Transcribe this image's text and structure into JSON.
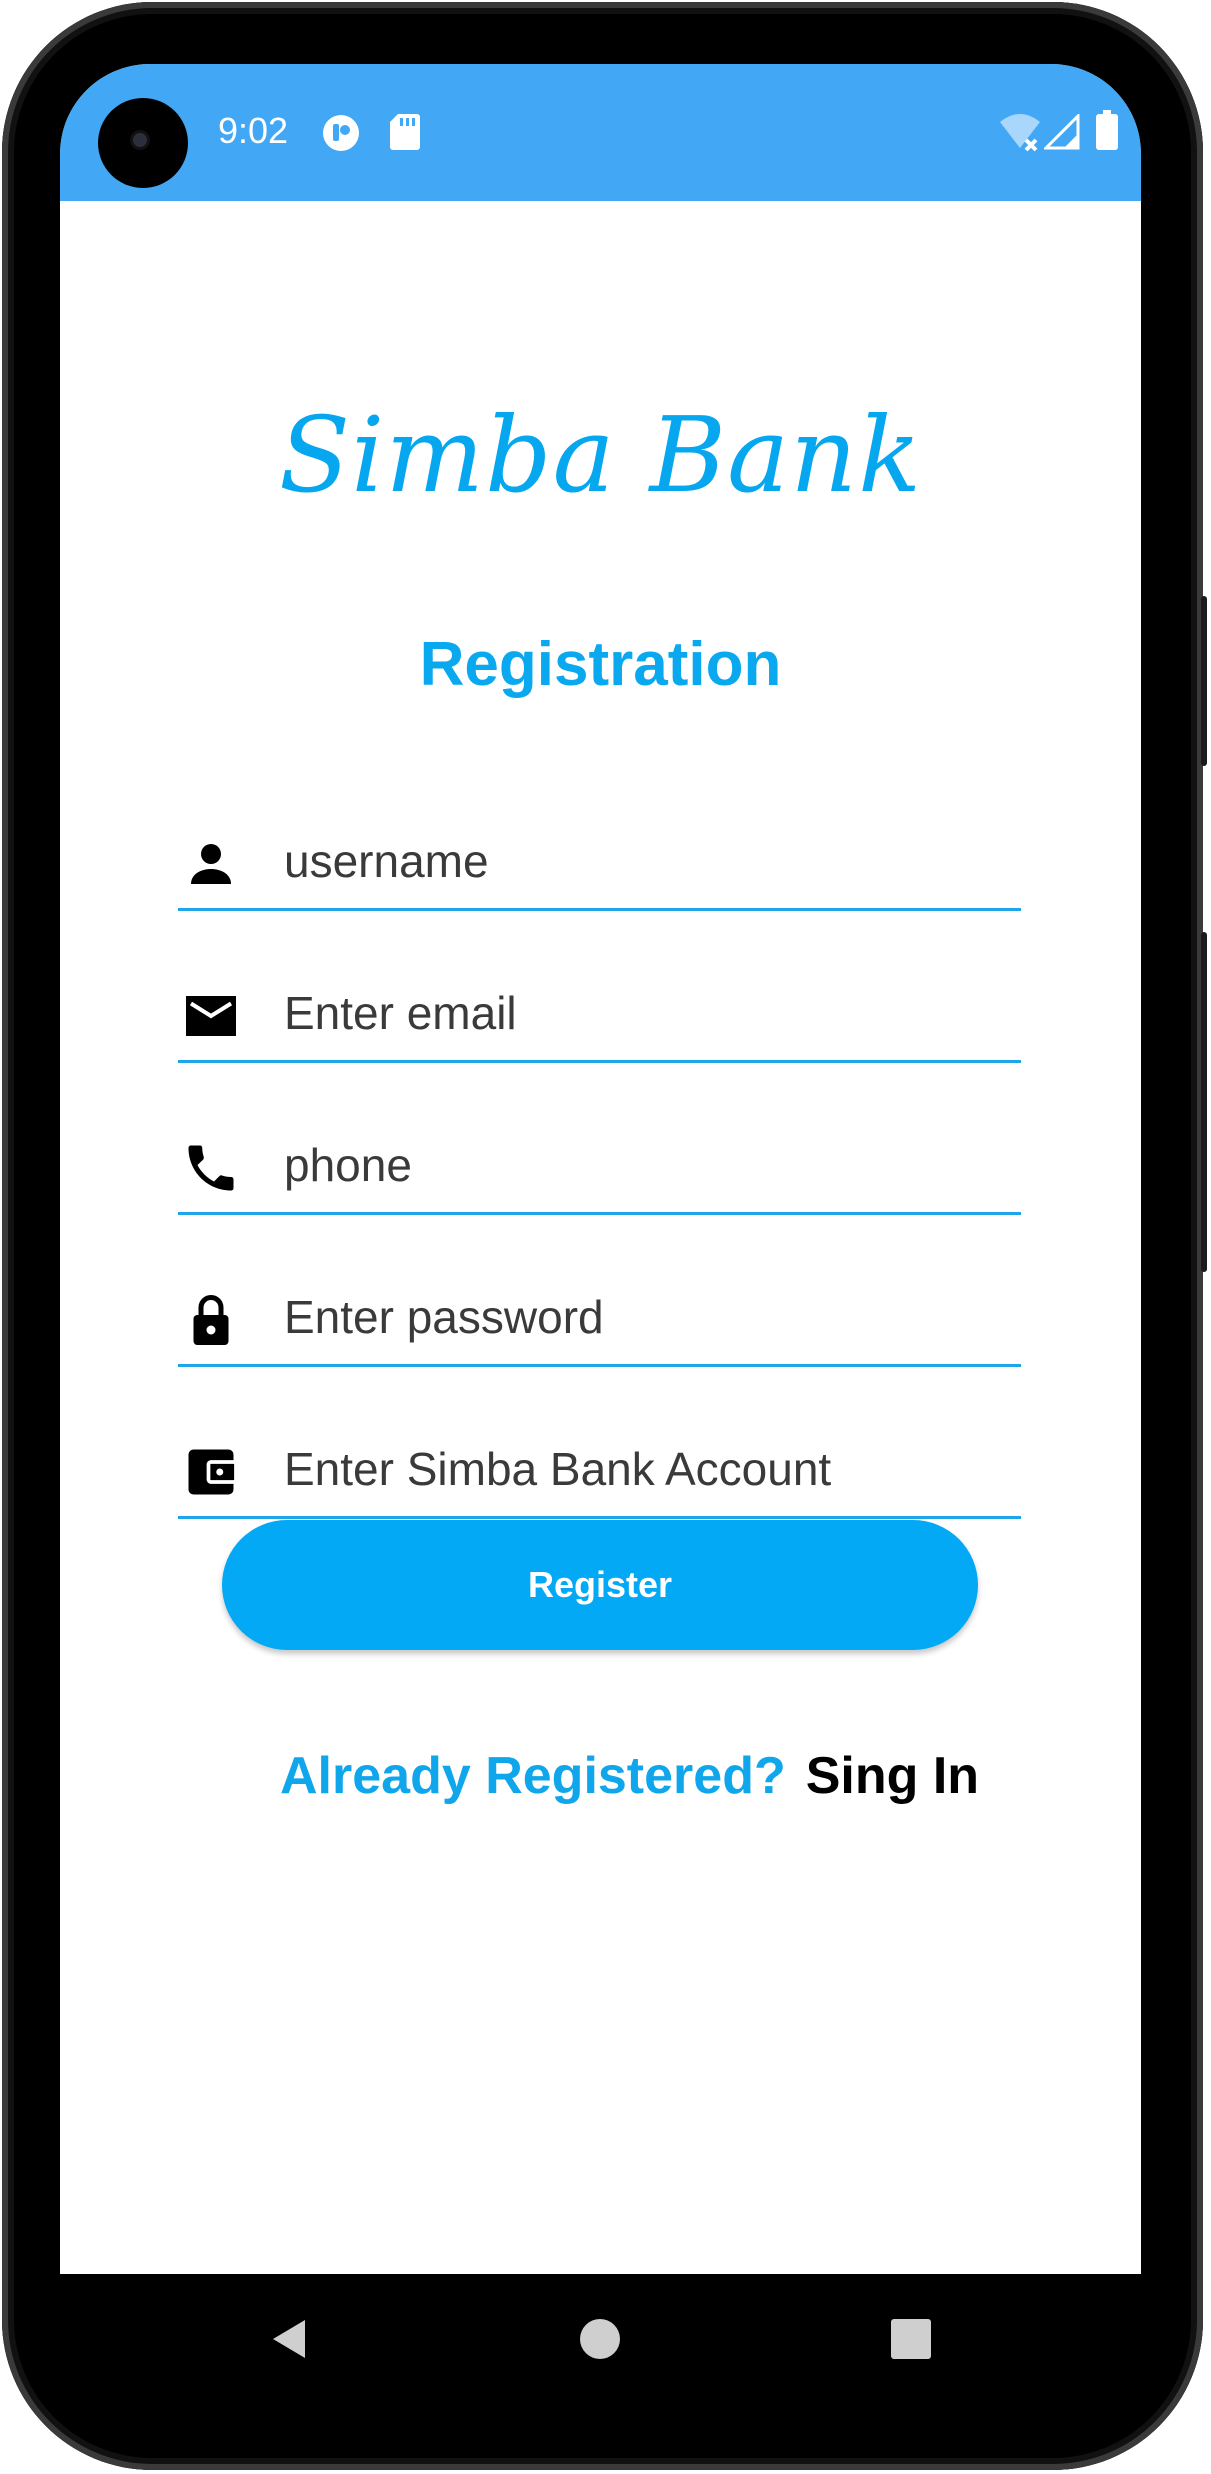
{
  "status_bar": {
    "time": "9:02",
    "icons": [
      "app-notification-icon",
      "sd-card-icon",
      "wifi-off-icon",
      "cell-signal-icon",
      "battery-icon"
    ]
  },
  "app": {
    "title": "Simba Bank",
    "heading": "Registration"
  },
  "form": {
    "fields": [
      {
        "icon": "person-icon",
        "value": "",
        "placeholder": "username"
      },
      {
        "icon": "email-icon",
        "value": "",
        "placeholder": "Enter email"
      },
      {
        "icon": "phone-icon",
        "value": "",
        "placeholder": "phone"
      },
      {
        "icon": "lock-icon",
        "value": "",
        "placeholder": "Enter password"
      },
      {
        "icon": "wallet-icon",
        "value": "",
        "placeholder": "Enter Simba Bank Account"
      }
    ],
    "register_label": "Register",
    "already_label": "Already Registered?",
    "signin_label": "Sing In"
  },
  "navigation": {
    "buttons": [
      "back-icon",
      "home-icon",
      "recents-icon"
    ]
  },
  "colors": {
    "status_bar": "#42a7f5",
    "accent": "#03a9f4",
    "underline": "#1ea6e8"
  }
}
